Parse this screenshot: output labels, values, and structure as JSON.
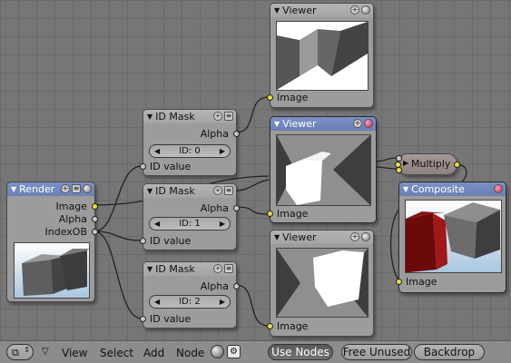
{
  "nodes": {
    "render": {
      "title": "Render",
      "outputs": [
        "Image",
        "Alpha",
        "IndexOB"
      ]
    },
    "idmask1": {
      "title": "ID Mask",
      "alpha": "Alpha",
      "id_field": "ID: 0",
      "id_value": "ID value"
    },
    "idmask2": {
      "title": "ID Mask",
      "alpha": "Alpha",
      "id_field": "ID: 1",
      "id_value": "ID value"
    },
    "idmask3": {
      "title": "ID Mask",
      "alpha": "Alpha",
      "id_field": "ID: 2",
      "id_value": "ID value"
    },
    "viewer_top": {
      "title": "Viewer",
      "image": "Image"
    },
    "viewer_mid": {
      "title": "Viewer",
      "image": "Image"
    },
    "viewer_bot": {
      "title": "Viewer",
      "image": "Image"
    },
    "multiply": {
      "title": "Multiply"
    },
    "composite": {
      "title": "Composite",
      "image": "Image"
    }
  },
  "toolbar": {
    "menus": [
      "View",
      "Select",
      "Add",
      "Node"
    ],
    "use_nodes": "Use Nodes",
    "free_unused": "Free Unused",
    "backdrop": "Backdrop"
  },
  "colors": {
    "selected_header": "#6a80b6",
    "socket_image": "#e6e03a",
    "socket_value": "#c8c8c8",
    "node_body": "#9c9c9c"
  }
}
